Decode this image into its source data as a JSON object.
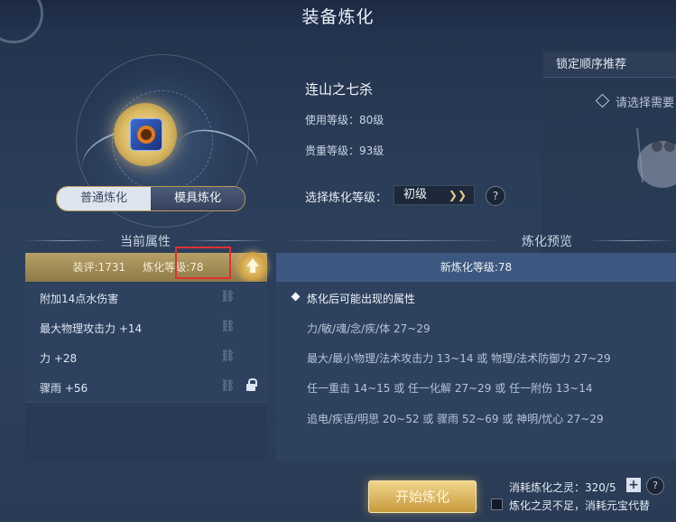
{
  "header": {
    "title": "装备炼化"
  },
  "tabs": [
    {
      "label": "普通炼化"
    },
    {
      "label": "模具炼化"
    }
  ],
  "item": {
    "name": "连山之七杀",
    "use_level": "使用等级：80级",
    "value_level": "贵重等级：93级"
  },
  "refine_select": {
    "label": "选择炼化等级：",
    "value": "初级",
    "help": "?"
  },
  "recommend": {
    "button": "锁定顺序推荐",
    "hint": "请选择需要"
  },
  "sections": {
    "current": "当前属性",
    "preview": "炼化预览"
  },
  "current_panel": {
    "score": "装评:1731",
    "refine_level": "炼化等级:78",
    "attributes": [
      {
        "text": "附加14点水伤害",
        "locked": false
      },
      {
        "text": "最大物理攻击力 +14",
        "locked": false
      },
      {
        "text": "力 +28",
        "locked": false
      },
      {
        "text": "骤雨 +56",
        "locked": true
      }
    ]
  },
  "preview_panel": {
    "new_level": "新炼化等级:78",
    "subtitle": "炼化后可能出现的属性",
    "lines": [
      "力/敏/魂/念/疾/体 27~29",
      "最大/最小物理/法术攻击力 13~14 或 物理/法术防御力 27~29",
      "任一重击 14~15 或 任一化解 27~29 或 任一附伤 13~14",
      "追电/疾语/明思 20~52 或 骤雨 52~69 或 神明/忧心 27~29"
    ]
  },
  "bottom": {
    "start_button": "开始炼化",
    "cost": "消耗炼化之灵：320/5",
    "plus": "+",
    "help": "?",
    "checkbox_label": "炼化之灵不足，消耗元宝代替"
  },
  "colors": {
    "background": "#2b3d58",
    "gold_accent": "#c99a3c",
    "highlight_box": "#e23030",
    "preview_header": "#3d5880"
  }
}
